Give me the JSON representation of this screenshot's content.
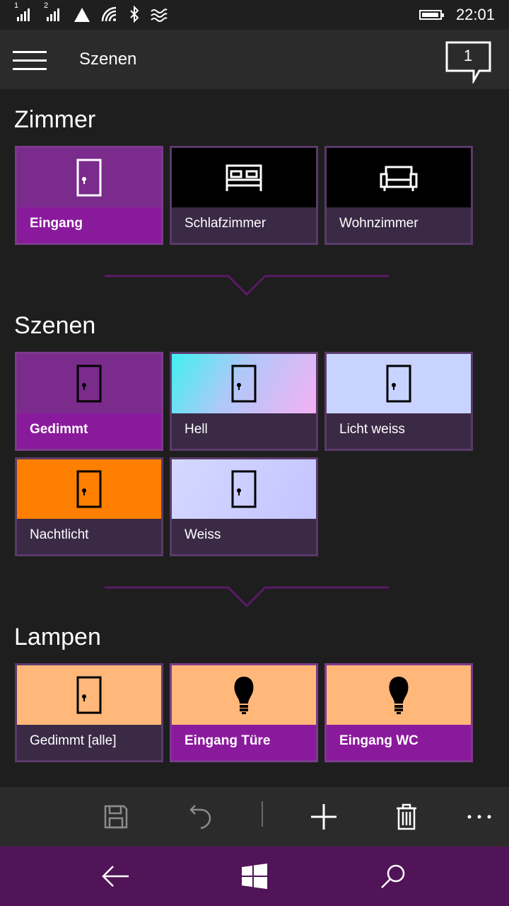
{
  "status": {
    "sim1": "1",
    "sim2": "2",
    "time": "22:01"
  },
  "appbar": {
    "title": "Szenen",
    "notification_count": "1"
  },
  "sections": {
    "rooms": {
      "title": "Zimmer",
      "tiles": [
        {
          "label": "Eingang",
          "icon": "door-icon",
          "active": true
        },
        {
          "label": "Schlafzimmer",
          "icon": "bed-icon",
          "active": false
        },
        {
          "label": "Wohnzimmer",
          "icon": "sofa-icon",
          "active": false
        }
      ]
    },
    "scenes": {
      "title": "Szenen",
      "tiles": [
        {
          "label": "Gedimmt",
          "icon": "door-icon",
          "active": true
        },
        {
          "label": "Hell",
          "icon": "door-icon",
          "active": false
        },
        {
          "label": "Licht weiss",
          "icon": "door-icon",
          "active": false
        },
        {
          "label": "Nachtlicht",
          "icon": "door-icon",
          "active": false
        },
        {
          "label": "Weiss",
          "icon": "door-icon",
          "active": false
        }
      ]
    },
    "lamps": {
      "title": "Lampen",
      "tiles": [
        {
          "label": "Gedimmt [alle]",
          "icon": "door-icon",
          "active": false
        },
        {
          "label": "Eingang Türe",
          "icon": "bulb-icon",
          "active": true
        },
        {
          "label": "Eingang WC",
          "icon": "bulb-icon",
          "active": true
        }
      ]
    }
  },
  "commands": [
    "save-icon",
    "undo-icon",
    "add-icon",
    "delete-icon",
    "more-icon"
  ],
  "colors": {
    "accent": "#8a1a9c",
    "accent_tile_top": "#7b2b8c",
    "tile_bottom": "#3a2a45",
    "nav_bar": "#521458",
    "orange": "#ff7f00",
    "peach": "#ffb87a",
    "lavender": "#cdd0ff"
  }
}
